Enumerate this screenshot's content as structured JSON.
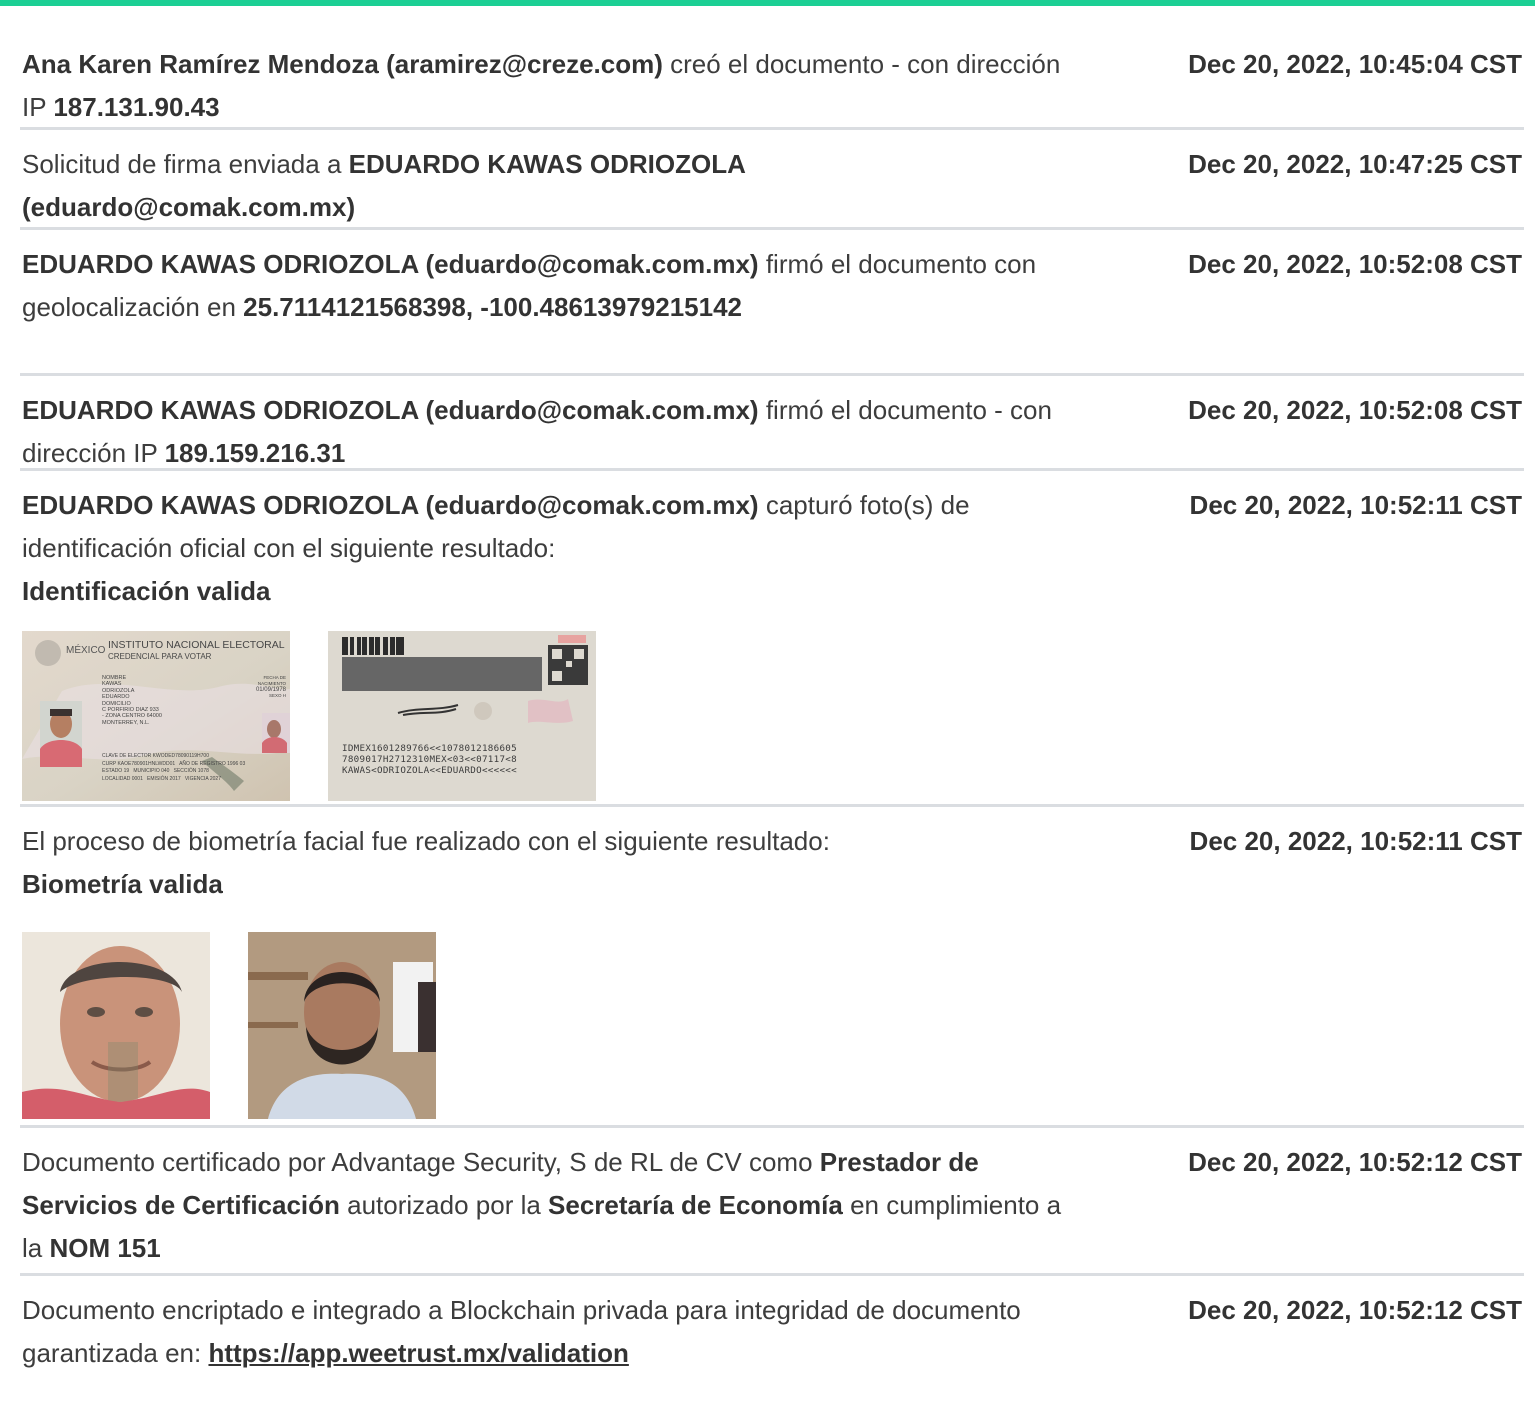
{
  "events": [
    {
      "actor": "Ana Karen Ramírez Mendoza (aramirez@creze.com)",
      "text_1": " creó el documento - con dirección IP ",
      "ip": "187.131.90.43",
      "timestamp": "Dec 20, 2022, 10:45:04 CST"
    },
    {
      "text_1": "Solicitud de firma enviada a ",
      "recipient": "EDUARDO KAWAS ODRIOZOLA (eduardo@comak.com.mx)",
      "timestamp": "Dec 20, 2022, 10:47:25 CST"
    },
    {
      "actor": "EDUARDO KAWAS ODRIOZOLA (eduardo@comak.com.mx)",
      "text_1": " firmó el documento con geolocalización en ",
      "geo": "25.7114121568398, -100.48613979215142",
      "timestamp": "Dec 20, 2022, 10:52:08 CST"
    },
    {
      "actor": "EDUARDO KAWAS ODRIOZOLA (eduardo@comak.com.mx)",
      "text_1": " firmó el documento - con dirección IP ",
      "ip": "189.159.216.31",
      "timestamp": "Dec 20, 2022, 10:52:08 CST"
    },
    {
      "actor": "EDUARDO KAWAS ODRIOZOLA (eduardo@comak.com.mx)",
      "text_1": " capturó foto(s) de identificación oficial con el siguiente resultado:",
      "result": "Identificación valida",
      "timestamp": "Dec 20, 2022, 10:52:11 CST",
      "id_front": {
        "country": "MÉXICO",
        "institute": "INSTITUTO NACIONAL ELECTORAL",
        "credential": "CREDENCIAL PARA VOTAR",
        "nombre_label": "NOMBRE",
        "name_lines": [
          "KAWAS",
          "ODRIOZOLA",
          "EDUARDO"
        ],
        "domicilio_label": "DOMICILIO",
        "address_lines": [
          "C PORFIRIO DIAZ 933",
          "- ZONA CENTRO 64000",
          "MONTERREY, N.L."
        ],
        "fecha_label": "FECHA DE NACIMIENTO",
        "birth": "01/09/1978",
        "sexo": "SEXO H",
        "clave": "CLAVE DE ELECTOR KWODED78090119H700",
        "curp": "CURP KAOE780901HNLWDD01",
        "registro": "AÑO DE REGISTRO 1996 03",
        "estado": "ESTADO 19",
        "municipio": "MUNICIPIO 040",
        "seccion": "SECCIÓN 1078",
        "localidad": "LOCALIDAD 0001",
        "emision": "EMISIÓN 2017",
        "vigencia": "VIGENCIA 2027"
      },
      "id_back": {
        "mrz": [
          "IDMEX1601289766<<1078012186605",
          "7809017H2712310MEX<03<<07117<8",
          "KAWAS<ODRIOZOLA<<EDUARDO<<<<<<"
        ]
      }
    },
    {
      "text_1": "El proceso de biometría facial fue realizado con el siguiente resultado:",
      "result": "Biometría valida",
      "timestamp": "Dec 20, 2022, 10:52:11 CST"
    },
    {
      "text_1": "Documento certificado por Advantage Security, S de RL de CV como ",
      "b1": "Prestador de Servicios de Certificación",
      "text_2": " autorizado por la ",
      "b2": "Secretaría de Economía",
      "text_3": " en cumplimiento a la ",
      "b3": "NOM 151",
      "timestamp": "Dec 20, 2022, 10:52:12 CST"
    },
    {
      "text_1": "Documento encriptado e integrado a Blockchain privada para integridad de documento garantizada en: ",
      "link": "https://app.weetrust.mx/validation",
      "timestamp": "Dec 20, 2022, 10:52:12 CST"
    }
  ],
  "colors": {
    "accent": "#1ccf94",
    "divider": "#dadde1",
    "text": "#3d3d3d"
  }
}
